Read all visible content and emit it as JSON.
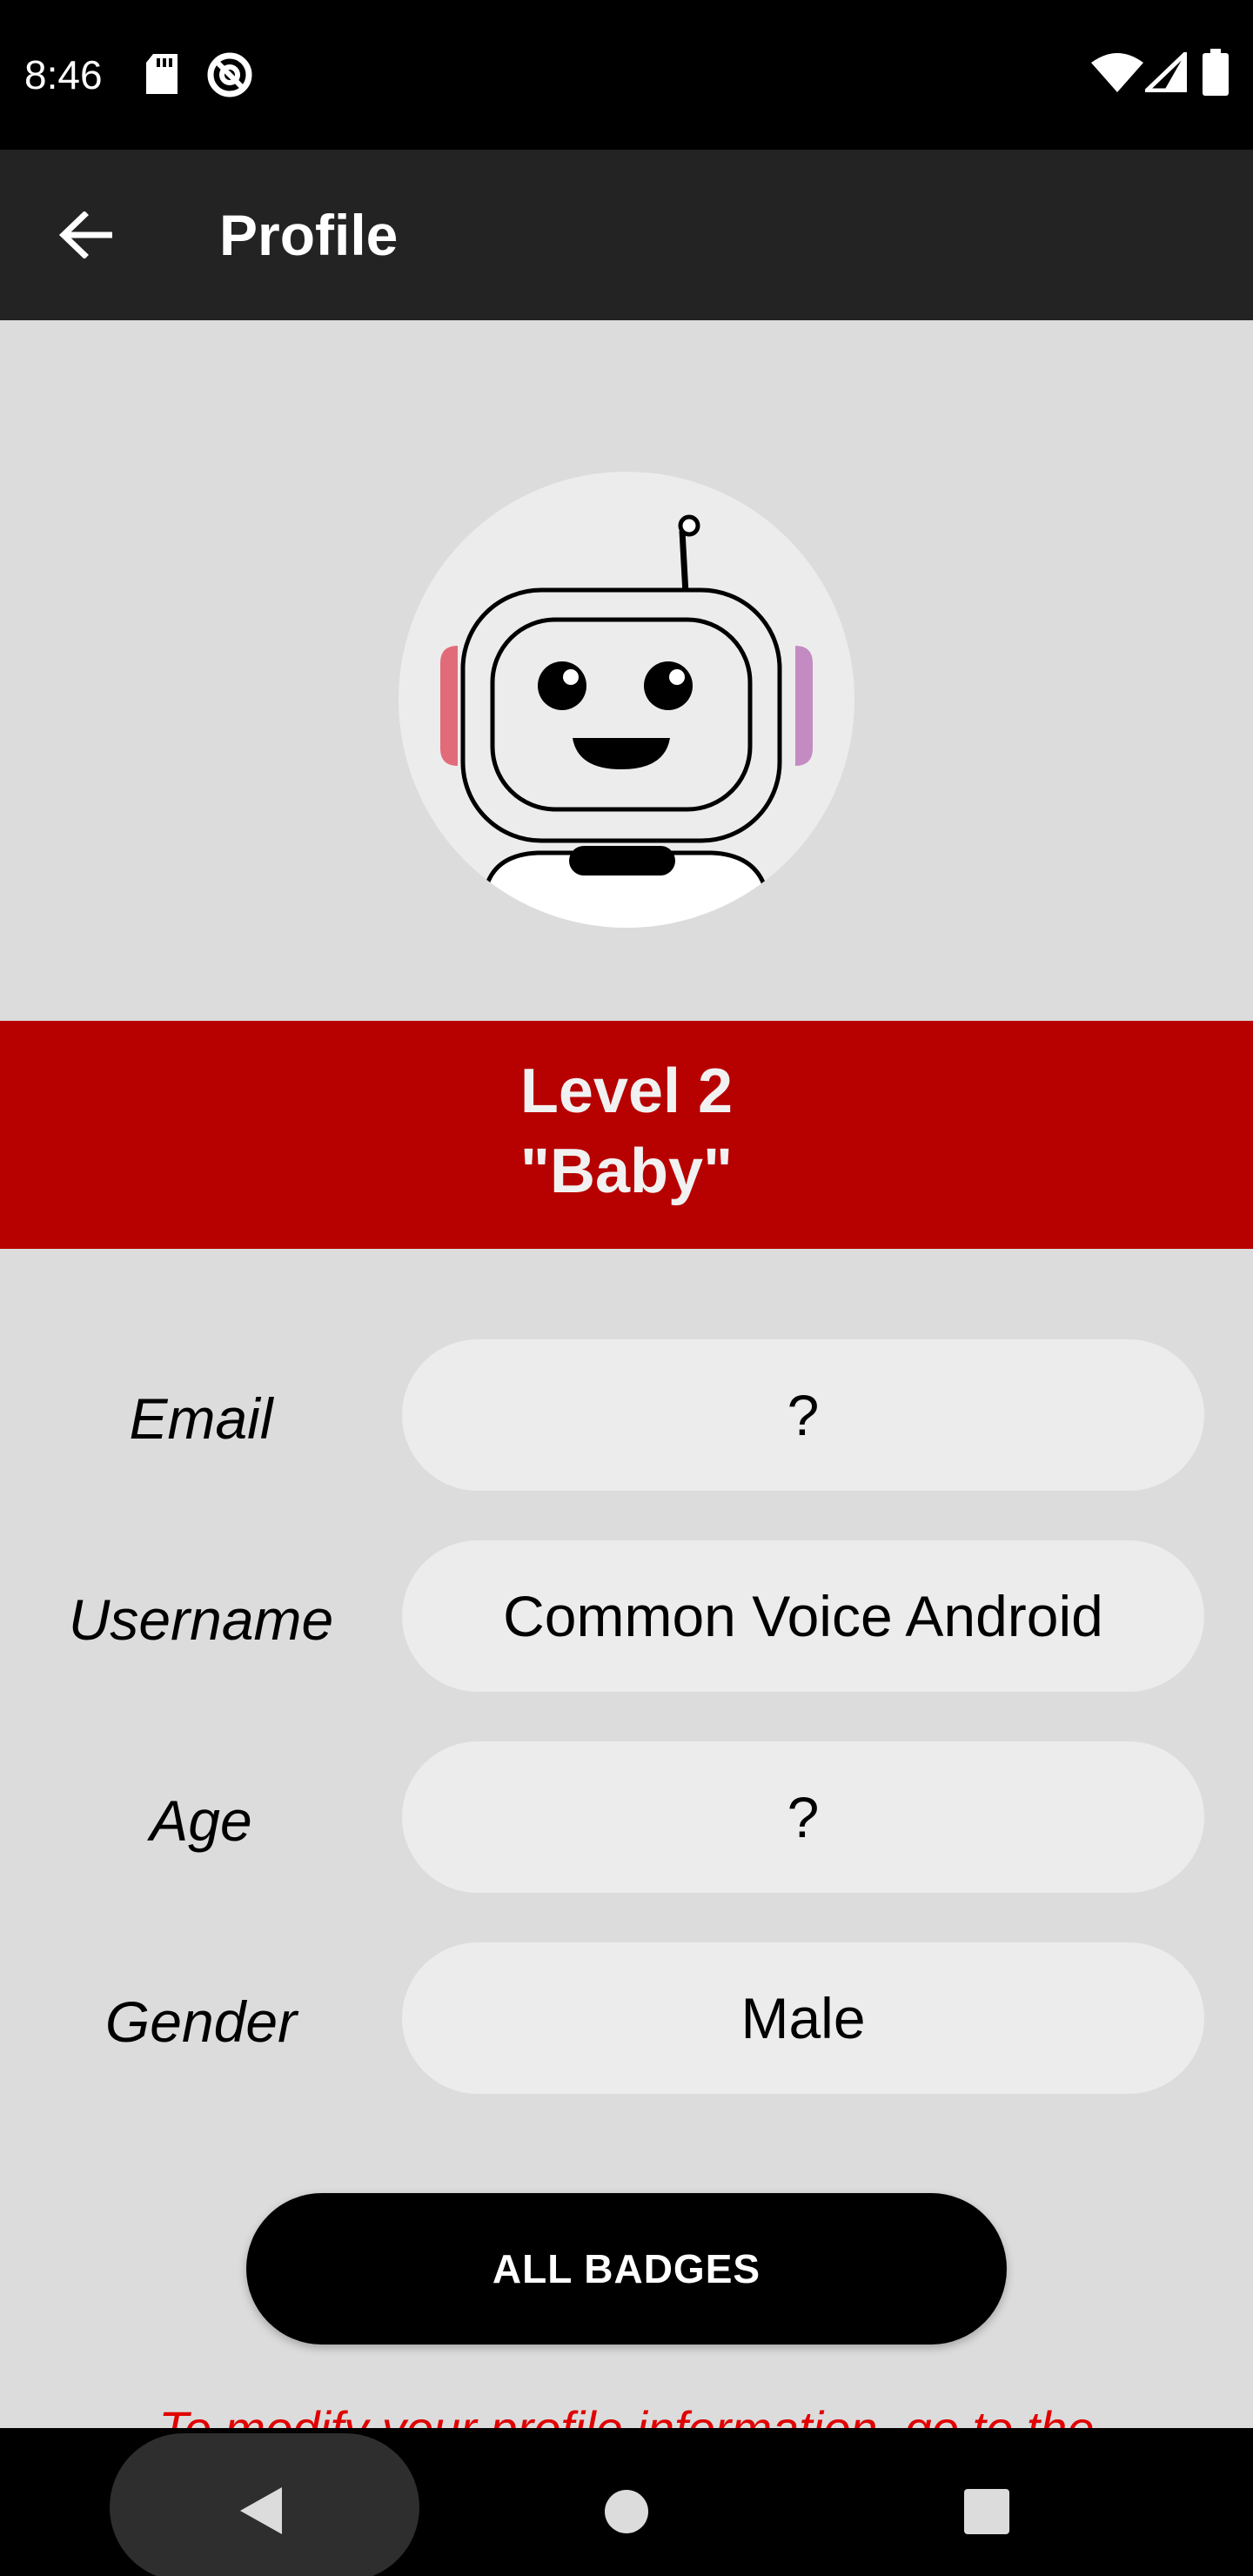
{
  "status_bar": {
    "time": "8:46",
    "icons_left": [
      "sd-card-icon",
      "no-disturb-icon"
    ],
    "icons_right": [
      "wifi-icon",
      "signal-icon",
      "battery-icon"
    ]
  },
  "app_bar": {
    "title": "Profile",
    "back_icon": "arrow-back-icon"
  },
  "level": {
    "line1": "Level 2",
    "line2": "\"Baby\""
  },
  "fields": {
    "email": {
      "label": "Email",
      "value": "?"
    },
    "username": {
      "label": "Username",
      "value": "Common Voice Android"
    },
    "age": {
      "label": "Age",
      "value": "?"
    },
    "gender": {
      "label": "Gender",
      "value": "Male"
    }
  },
  "button": {
    "all_badges": "ALL BADGES"
  },
  "footnote": "To modify your profile information, go to the",
  "colors": {
    "background": "#dcdcdc",
    "app_bar": "#232323",
    "banner": "#b70000",
    "field_bg": "#ececec",
    "footnote": "#e00000"
  }
}
